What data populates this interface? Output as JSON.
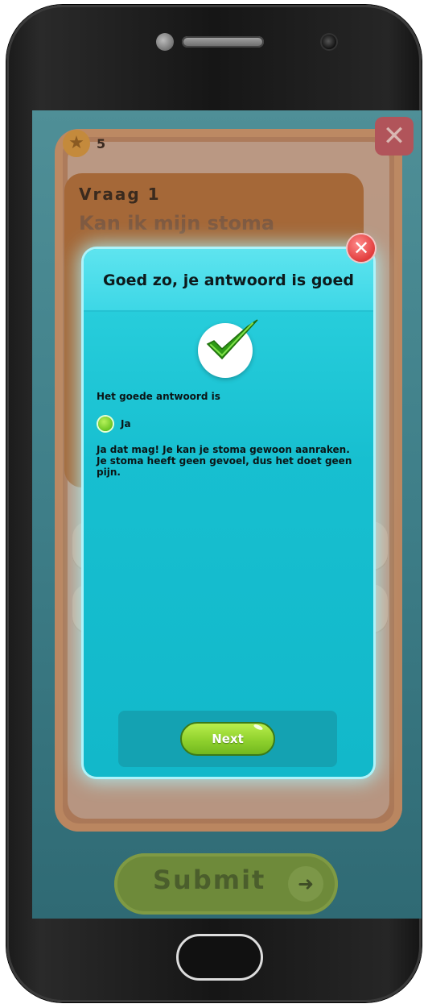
{
  "background_screen": {
    "score": "5",
    "question_label": "Vraag 1",
    "question_text": "Kan ik mijn stoma",
    "submit_label": "Submit",
    "icons": {
      "score": "star-coin-icon",
      "close": "close-icon",
      "submit_arrow": "arrow-right-icon"
    }
  },
  "modal": {
    "title": "Goed zo, je antwoord is goed",
    "answer_heading": "Het goede antwoord is",
    "answer_option": "Ja",
    "explanation": "Ja dat mag! Je kan je stoma gewoon aanraken. Je stoma heeft geen gevoel, dus het doet geen pijn.",
    "next_label": "Next",
    "icons": {
      "close": "close-circle-icon",
      "check": "checkmark-icon",
      "answer": "green-dot-icon"
    }
  },
  "colors": {
    "modal_bg": "#17bfd0",
    "modal_header": "#3dd7e6",
    "next_button": "#8fd12d",
    "close_button": "#e23d3d",
    "checkmark": "#3fae1c"
  }
}
